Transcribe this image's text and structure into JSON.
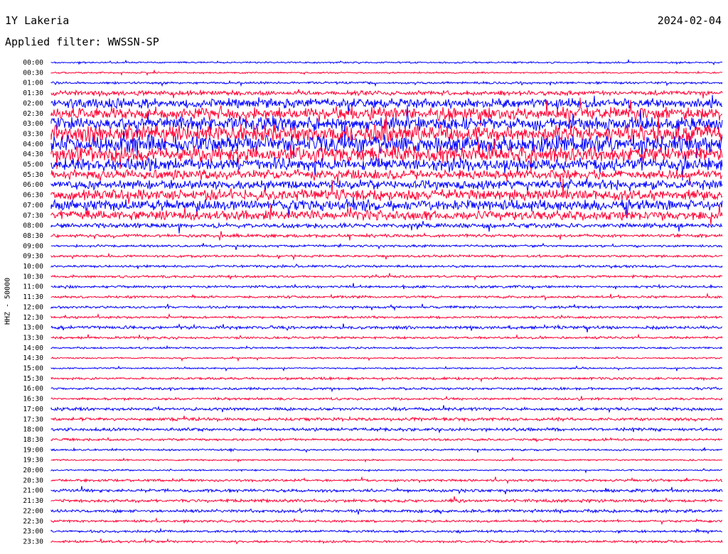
{
  "header": {
    "station": "1Y Lakeria",
    "date": "2024-02-04",
    "filter_text": "Applied filter: WWSSN-SP"
  },
  "chart_data": {
    "type": "line",
    "channel_label": "HHZ - 50000",
    "colors": [
      "#0000ff",
      "#ff0033"
    ],
    "rows": [
      {
        "label": "00:00",
        "amp": 1
      },
      {
        "label": "00:30",
        "amp": 1
      },
      {
        "label": "01:00",
        "amp": 1.5
      },
      {
        "label": "01:30",
        "amp": 3
      },
      {
        "label": "02:00",
        "amp": 6
      },
      {
        "label": "02:30",
        "amp": 8
      },
      {
        "label": "03:00",
        "amp": 9
      },
      {
        "label": "03:30",
        "amp": 11
      },
      {
        "label": "04:00",
        "amp": 11
      },
      {
        "label": "04:30",
        "amp": 10
      },
      {
        "label": "05:00",
        "amp": 8
      },
      {
        "label": "05:30",
        "amp": 6
      },
      {
        "label": "06:00",
        "amp": 6
      },
      {
        "label": "06:30",
        "amp": 7
      },
      {
        "label": "07:00",
        "amp": 7
      },
      {
        "label": "07:30",
        "amp": 6
      },
      {
        "label": "08:00",
        "amp": 3
      },
      {
        "label": "08:30",
        "amp": 2
      },
      {
        "label": "09:00",
        "amp": 1.5
      },
      {
        "label": "09:30",
        "amp": 1.5
      },
      {
        "label": "10:00",
        "amp": 1.5
      },
      {
        "label": "10:30",
        "amp": 1.5
      },
      {
        "label": "11:00",
        "amp": 1.5
      },
      {
        "label": "11:30",
        "amp": 1.5
      },
      {
        "label": "12:00",
        "amp": 1.5
      },
      {
        "label": "12:30",
        "amp": 1.5
      },
      {
        "label": "13:00",
        "amp": 2
      },
      {
        "label": "13:30",
        "amp": 1.5
      },
      {
        "label": "14:00",
        "amp": 1.2
      },
      {
        "label": "14:30",
        "amp": 1
      },
      {
        "label": "15:00",
        "amp": 1
      },
      {
        "label": "15:30",
        "amp": 1.5
      },
      {
        "label": "16:00",
        "amp": 1.5
      },
      {
        "label": "16:30",
        "amp": 1.5
      },
      {
        "label": "17:00",
        "amp": 2
      },
      {
        "label": "17:30",
        "amp": 2
      },
      {
        "label": "18:00",
        "amp": 2
      },
      {
        "label": "18:30",
        "amp": 1.5
      },
      {
        "label": "19:00",
        "amp": 1.2
      },
      {
        "label": "19:30",
        "amp": 1
      },
      {
        "label": "20:00",
        "amp": 1
      },
      {
        "label": "20:30",
        "amp": 1.5
      },
      {
        "label": "21:00",
        "amp": 2
      },
      {
        "label": "21:30",
        "amp": 2
      },
      {
        "label": "22:00",
        "amp": 2
      },
      {
        "label": "22:30",
        "amp": 1.5
      },
      {
        "label": "23:00",
        "amp": 1.5
      },
      {
        "label": "23:30",
        "amp": 1.5
      }
    ]
  }
}
